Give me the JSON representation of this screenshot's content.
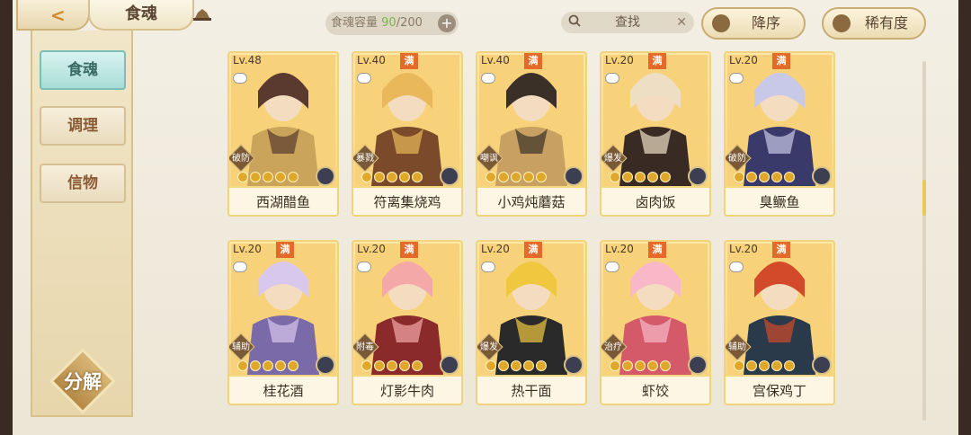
{
  "header": {
    "title": "食魂",
    "capacity_label": "食魂容量",
    "capacity_current": "90",
    "capacity_max": "/200",
    "capacity_add": "+",
    "search_placeholder": "查找",
    "search_clear": "✕",
    "sort_order_label": "降序",
    "sort_key_label": "稀有度"
  },
  "sidebar": {
    "tabs": [
      {
        "label": "食魂",
        "active": true
      },
      {
        "label": "调理",
        "active": false
      },
      {
        "label": "信物",
        "active": false
      }
    ],
    "decompose_label": "分解"
  },
  "colors": {
    "accent_gold": "#f0d37a",
    "active_tab": "#a9dcd7",
    "capacity_green": "#7bb54a",
    "full_badge": "#e46a2a"
  },
  "full_badge_text": "满",
  "cards": [
    {
      "level": "Lv.48",
      "full": false,
      "role": "破防",
      "name": "西湖醋鱼",
      "stars": 5
    },
    {
      "level": "Lv.40",
      "full": true,
      "role": "暴戮",
      "name": "符离集烧鸡",
      "stars": 5
    },
    {
      "level": "Lv.40",
      "full": true,
      "role": "嘲讽",
      "name": "小鸡炖蘑菇",
      "stars": 5
    },
    {
      "level": "Lv.20",
      "full": true,
      "role": "爆发",
      "name": "卤肉饭",
      "stars": 5
    },
    {
      "level": "Lv.20",
      "full": true,
      "role": "破防",
      "name": "臭鳜鱼",
      "stars": 5
    },
    {
      "level": "Lv.20",
      "full": true,
      "role": "辅助",
      "name": "桂花酒",
      "stars": 5
    },
    {
      "level": "Lv.20",
      "full": true,
      "role": "附毒",
      "name": "灯影牛肉",
      "stars": 5
    },
    {
      "level": "Lv.20",
      "full": true,
      "role": "爆发",
      "name": "热干面",
      "stars": 5
    },
    {
      "level": "Lv.20",
      "full": true,
      "role": "治疗",
      "name": "虾饺",
      "stars": 5
    },
    {
      "level": "Lv.20",
      "full": true,
      "role": "辅助",
      "name": "宫保鸡丁",
      "stars": 5
    }
  ]
}
